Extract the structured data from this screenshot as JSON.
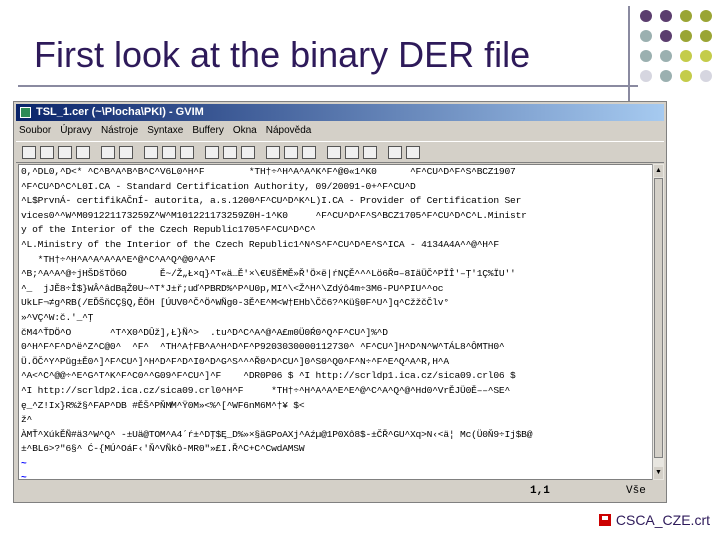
{
  "slide": {
    "title": "First look at the binary DER file",
    "caption": "CSCA_CZE.crt",
    "dot_colors": [
      "#5b3d6e",
      "#9aa534",
      "#9bb0b0",
      "#c4cc4a",
      "#d6d6e0"
    ]
  },
  "window": {
    "title": "TSL_1.cer (~\\Plocha\\PKI) - GVIM",
    "menu": [
      "Soubor",
      "Úpravy",
      "Nástroje",
      "Syntaxe",
      "Buffery",
      "Okna",
      "Nápověda"
    ],
    "toolbar_icons": [
      "open-icon",
      "save-icon",
      "save-all-icon",
      "print-icon",
      "undo-icon",
      "redo-icon",
      "cut-icon",
      "copy-icon",
      "paste-icon",
      "replace-icon",
      "find-next-icon",
      "find-prev-icon",
      "load-session-icon",
      "save-session-icon",
      "run-script-icon",
      "make-icon",
      "run-ctags-icon",
      "jump-tag-icon",
      "help-icon",
      "find-help-icon"
    ]
  },
  "editor": {
    "lines": [
      "0,^DL0,^D<* ^C^B^A^B^B^C^V6L0^H^F        *TH†÷^H^A^A^K^F^@0«1^K0      ^F^CU^D^F^S^BCZ1907",
      "^F^CU^D^C^L0I.CA - Standard Certification Authority, 09/20091-0+^F^CU^D",
      "^L$PrvnÁ- certifikAČnÍ- autorita, a.s.1200^F^CU^D^K^L)I.CA - Provider of Certification Ser",
      "vices0^^W^M091221173259Z^W^M101221173259Z0H-1^K0     ^F^CU^D^F^S^BCZ1705^F^CU^D^C^L.Ministr",
      "y of the Interior of the Czech Republic1705^F^CU^D^C^",
      "^L.Ministry of the Interior of the Czech Republic1^N^S^F^CU^D^E^S^ICA - 4134A4A^^@^H^F",
      "   *TH†÷^H^A^A^A^A^E^@^C^A^Q^@0^A^F",
      "^B;^A^A^@÷jHŠDšTÖ6O      Ě~/Ž„Ł×q}^T«ä…Ě'×\\€UšĚMĚ»Ř'Ö×ë|ŕNÇĚ^^^Lö6Ř¤–8IäÜČ^PÏÎ'–Ţ'1Ç%ÏU''",
      "^_  jJĚ8÷Î$}WÂ^âdBąŽ0U~^T*J±ř;uď^PBRD%^P^U0p,MI^\\<Ž^H^\\Zdýô4m÷3M6-PU^PIU^^oc",
      "UkLF¬≠g^RB(/EĎŠňCÇ§Q,ĚÖH [ÚUV0^Č^Ö^WÑg0-3Ě^E^M<W†EHb\\Čč6?^Kü§0F^U^]q^CžžčČlv°",
      "»^VÇ^W:č.'_^Ţ",
      "čM4^ŤDÖ^O       ^T^X0^DÛž],Ł}Ñ^>  .tu^D^C^A^@^A£m0Ü0Ŕ0^Q^F^CU^]%^D",
      "0^H^F^F^D^ë^Z^C@0^  ^F^  ^TH^A†FB^A^H^D^F^P9203030000112730^ ^F^CU^]H^D^N^W^TÁL8^ÔMTH0^",
      "Ü.ÖČ^Y^Pŭg±Ě0^]^F^CU^]^H^D^F^D^I0^D^G^S^^^Ř0^D^CU^]0^S0^Q0^F^N÷^F^E^Q^A^R,H^A",
      "^A<^C^@@÷^E^G^T^K^F^C0^^G09^F^CU^]^F    ^DR0P06 $ ^I http://scrldp1.ica.cz/sica09.crl06 $",
      "^I http://scrldp2.ica.cz/sica09.crl0^H^F     *TH†÷^H^A^A^E^E^@^C^A^Q^@^Hd0^VrĚJÜ0Ě––^SE^",
      "ę_^Z!Ix}R%ž§^FAP^DB #ĚŠ^PŇM̸M^Ÿ0M»<%^[^WF6nM6M^†¥ $<",
      "ž^",
      "ÀMŤ^XúkĚÑ#ä3^W^Q^ -±Uä@TOM^A4´ŕ±^DŢ$Ę_D%»×§äGPoAXj^Aźµ@1P0Xô8$-±ČŘ^GU^Xq>N‹<ä¦ Mc(Ü0Ň9÷Ij$B@",
      "±^BL6>?\"6§^ Ć-{MÚ^OáF‹'Ň^VÑkô-MR0\"»£I.Ř^C+C^CwdAMSW"
    ],
    "empty_marker": "~",
    "empty_line_count": 2,
    "status_position": "1,1",
    "status_scroll": "Vše"
  }
}
